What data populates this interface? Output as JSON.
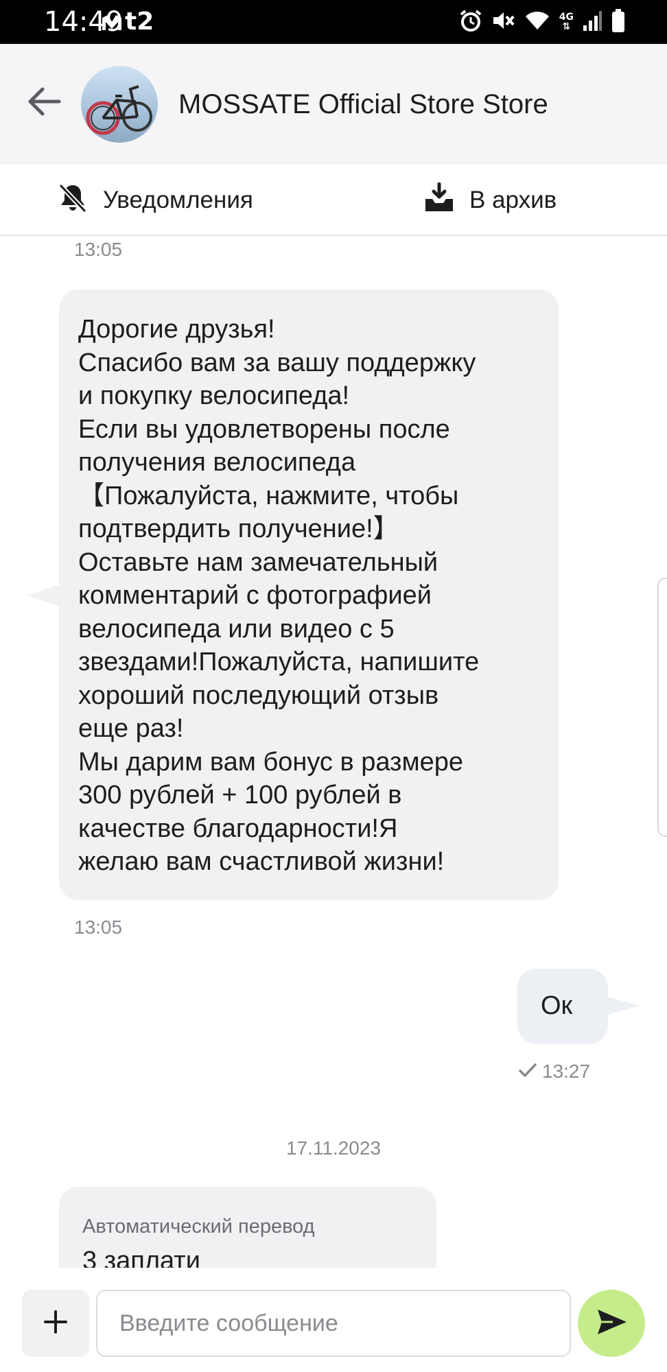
{
  "status_bar": {
    "time": "14:49",
    "carrier": "t2",
    "icons": [
      "mail-icon",
      "alarm-icon",
      "mute-icon",
      "wifi-icon",
      "4g-icon",
      "signal-icon",
      "battery-icon"
    ],
    "network_label": "4G"
  },
  "header": {
    "title": "MOSSATE Official Store Store",
    "back_icon": "arrow-left-icon",
    "avatar": "bicycle-avatar"
  },
  "actions": {
    "notifications_label": "Уведомления",
    "notifications_icon": "bell-muted-icon",
    "archive_label": "В архив",
    "archive_icon": "archive-icon"
  },
  "chat": {
    "top_timestamp": "13:05",
    "incoming_message": "Дорогие друзья!\nСпасибо вам за вашу поддержку\nи покупку велосипеда!\nЕсли вы удовлетворены после\nполучения велосипеда\n【Пожалуйста, нажмите, чтобы\nподтвердить получение!】\nОставьте нам замечательный\nкомментарий с фотографией\nвелосипеда или видео с 5\nзвездами!Пожалуйста, напишите\nхороший последующий отзыв\nеще раз!\nМы дарим вам бонус в размере\n300 рублей + 100 рублей в\nкачестве благодарности!Я\nжелаю вам счастливой жизни!",
    "incoming_timestamp": "13:05",
    "outgoing_message": "Ок",
    "outgoing_timestamp": "13:27",
    "outgoing_status_icon": "checkmark-icon",
    "date_separator": "17.11.2023",
    "partial_message": {
      "translation_label": "Автоматический перевод",
      "text": "3 заплати"
    }
  },
  "composer": {
    "placeholder": "Введите сообщение",
    "plus_icon": "plus-icon",
    "send_icon": "send-icon"
  },
  "colors": {
    "status_bar": "#000000",
    "header_bg": "#f5f5f7",
    "incoming_bubble": "#f1f1f3",
    "outgoing_bubble": "#ecf0f4",
    "send_button": "#c5ec8a",
    "muted_text": "#8a8a90"
  }
}
